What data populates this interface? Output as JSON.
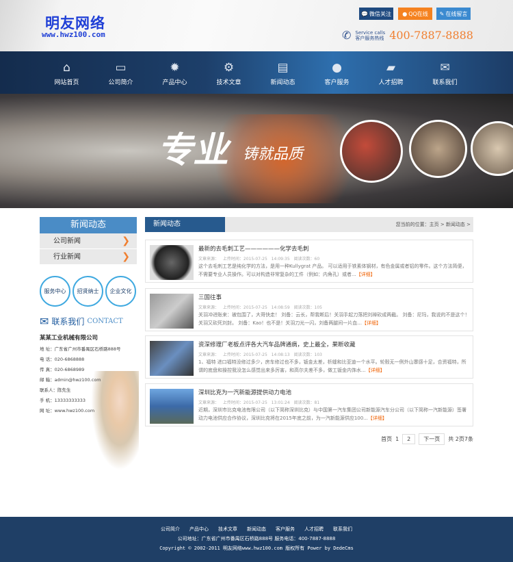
{
  "header": {
    "logo": "明友网络",
    "url": "www.hwz100.com",
    "buttons": [
      "微信关注",
      "QQ在线",
      "在线留言"
    ],
    "service_en": "Service calls",
    "service_cn": "客户服务热线",
    "phone": "400-7887-8888"
  },
  "nav": [
    {
      "label": "网站首页",
      "icon": "⌂"
    },
    {
      "label": "公司简介",
      "icon": "▭"
    },
    {
      "label": "产品中心",
      "icon": "✹"
    },
    {
      "label": "技术文章",
      "icon": "⚙"
    },
    {
      "label": "新闻动态",
      "icon": "▤"
    },
    {
      "label": "客户服务",
      "icon": "●"
    },
    {
      "label": "人才招聘",
      "icon": "▰"
    },
    {
      "label": "联系我们",
      "icon": "✉"
    }
  ],
  "banner": {
    "slogan": "专业",
    "slogan2": "铸就品质"
  },
  "sidebar": {
    "title": "新闻动态",
    "items": [
      "公司新闻",
      "行业新闻"
    ],
    "bubbles": [
      "服务中心",
      "招贤纳士",
      "企业文化"
    ],
    "contact_title": "联系我们",
    "contact_en": "CONTACT",
    "company": "某某工业机械有限公司",
    "lines": [
      "地 址：广东省广州市番禺区石桥路888号",
      "电 话：020-6868888",
      "传 真：020-6868989",
      "邮 箱：admin@hwz100.com",
      "联系人：陈先生",
      "手 机：13333333333",
      "网 址：www.hwz100.com"
    ]
  },
  "main": {
    "title": "新闻动态",
    "breadcrumb": "您当前的位置：主页 > 新闻动态 >",
    "more": "【详细】",
    "items": [
      {
        "title": "最新的去毛刺工艺——————化学去毛刺",
        "meta": "文章来源：   上传时间：2015-07-25 14:09:35   阅读次数：60",
        "desc": "这个去毛刺工艺是纯化学的方法，是用一种Kullygrat 产品。 可以适用于铁素体钢材，有色金属或者铝的零件。这个方法简便，不需要专业人员操作。可以对构造非常复杂的工件（例如：内角孔）或者..."
      },
      {
        "title": "三国往事",
        "meta": "文章来源：   上传时间：2015-07-25 14:08:59   阅读次数：105",
        "desc": "关羽冲进账来：被包围了，大哥快走！ 刘备：云长，帮我断后！关羽手起刀落把刘禅砍成两截。 刘备：尼玛，我说的不是这个！关羽又砍死刘封。 刘备：Kao！也不是！关羽刀光一闪，刘备两腿间一片血..."
      },
      {
        "title": "资深修理厂老板点评各大汽车品牌通病，史上最全，果断收藏",
        "meta": "文章来源：   上传时间：2015-07-25 14:08:13   阅读次数：103",
        "desc": "1、福特 进口福特没修过多少，房车修过也不多，钣金太差，析缝和比亚迪一个水平。轮毂无一例外山寨感十足，合资福特，所谓的底盘和操控我没怎么感觉出来多厉害，和高尔夫差不多，做工钣金内饰水..."
      },
      {
        "title": "深圳比克为一汽新能源提供动力电池",
        "meta": "文章来源：   上传时间：2015-07-25 13:01:24   阅读次数：81",
        "desc": "近期，深圳市比克电池有限公司（以下简称深圳比克）与中国第一汽车集团公司新能源汽车分公司（以下简称一汽新能源）签署动力电池供应合作协议，深圳比克将在2015年底之前，为一汽新能源供应100..."
      }
    ],
    "pager": {
      "first": "首页",
      "p1": "1",
      "p2": "2",
      "next": "下一页",
      "total": "共 2页7条"
    }
  },
  "footer": {
    "links": [
      "公司简介",
      "产品中心",
      "技术文章",
      "新闻动态",
      "客户服务",
      "人才招聘",
      "联系我们"
    ],
    "address": "公司地址：广东省广州市番禺区石桥路888号 服务电话：400-7887-8888",
    "copyright": "Copyright © 2002-2011 明友网络www.hwz100.com 版权所有  Power by DedeCms"
  },
  "colors": {
    "nav": "#1d3f6a",
    "accent": "#f07f30",
    "footer": "#1f3f66"
  }
}
